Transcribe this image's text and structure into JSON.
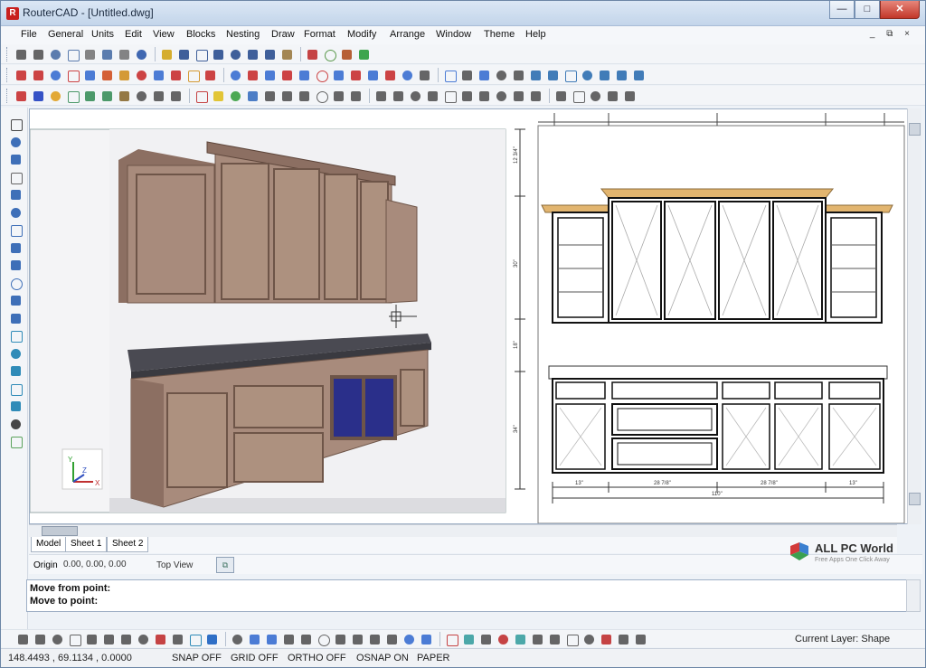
{
  "window": {
    "title": "RouterCAD - [Untitled.dwg]",
    "app_icon_glyph": "R",
    "controls": {
      "minimize": "—",
      "maximize": "□",
      "close": "✕"
    }
  },
  "menu": {
    "items": [
      "File",
      "General",
      "Units",
      "Edit",
      "View",
      "Blocks",
      "Nesting",
      "Draw",
      "Format",
      "Modify",
      "Arrange",
      "Window",
      "Theme",
      "Help"
    ],
    "mdi_controls": "_ ⧉ ×"
  },
  "toolbar_colors": {
    "row1": [
      "#555",
      "#555",
      "#4a6fa5",
      "#4a6fa5",
      "#777",
      "#4a6fa5",
      "#777",
      "#2b58a8",
      "#d1a517",
      "#2b4f8f",
      "#2b4f8f",
      "#2b4f8f",
      "#2b4f8f",
      "#2b4f8f",
      "#2b4f8f",
      "#9a7a40",
      "#c03030",
      "#4a8f3a",
      "#b05020",
      "#2a9c3a"
    ],
    "row2": [
      "#c83030",
      "#c83030",
      "#3a6fd0",
      "#c83030",
      "#3a6fd0",
      "#d05020",
      "#d09020",
      "#c83030",
      "#3a6fd0",
      "#c83030",
      "#d09020",
      "#c83030",
      "#3a6fd0",
      "#c83030",
      "#3a6fd0",
      "#c83030",
      "#3a6fd0",
      "#c83030",
      "#3a6fd0",
      "#c83030",
      "#3a6fd0",
      "#c83030",
      "#3a6fd0",
      "#555",
      "#3a6fd0",
      "#555",
      "#3a6fd0",
      "#555",
      "#555",
      "#2e6fb0",
      "#2e6fb0",
      "#2e6fb0",
      "#2e6fb0",
      "#2e6fb0",
      "#2e6fb0",
      "#2e6fb0"
    ],
    "row3": [
      "#c83030",
      "#2040c0",
      "#e0a020",
      "#3a8f5a",
      "#3a8f5a",
      "#3a8f5a",
      "#8a6a30",
      "#555",
      "#555",
      "#555",
      "#c03030",
      "#e0c020",
      "#3aa040",
      "#3a70c0",
      "#555",
      "#555",
      "#555",
      "#555",
      "#555",
      "#555",
      "#555",
      "#555",
      "#555",
      "#555",
      "#555",
      "#555",
      "#555",
      "#555",
      "#555",
      "#555",
      "#555",
      "#555",
      "#555",
      "#555",
      "#555"
    ],
    "left": [
      "#333",
      "#2a60b0",
      "#2a60b0",
      "#555",
      "#2a60b0",
      "#2a60b0",
      "#2a60b0",
      "#2a60b0",
      "#2a60b0",
      "#2a60b0",
      "#2a60b0",
      "#2a60b0",
      "#1a80b0",
      "#1a80b0",
      "#1a80b0",
      "#1a80b0",
      "#1a80b0",
      "#333",
      "#4a9a4a"
    ],
    "bottom": [
      "#555",
      "#555",
      "#555",
      "#555",
      "#555",
      "#555",
      "#555",
      "#555",
      "#c03030",
      "#555",
      "#1a80b0",
      "#1a60c0",
      "#555",
      "#3a6fd0",
      "#3a6fd0",
      "#555",
      "#555",
      "#555",
      "#555",
      "#555",
      "#555",
      "#555",
      "#3a6fd0",
      "#3a6fd0",
      "#c03030",
      "#3aa0a0",
      "#555",
      "#c03030",
      "#3aa0a0",
      "#555",
      "#555",
      "#555",
      "#555",
      "#c03030",
      "#555",
      "#555"
    ]
  },
  "tabs": [
    "Model",
    "Sheet 1",
    "Sheet 2"
  ],
  "info": {
    "origin_label": "Origin",
    "origin_value": "0.00, 0.00, 0.00",
    "view_label": "Top View",
    "view_icon_glyph": "⧉"
  },
  "watermark": {
    "title": "ALL PC World",
    "subtitle": "Free Apps One Click Away"
  },
  "command": {
    "lines": [
      "Move from point:",
      "Move to point:"
    ]
  },
  "bottom_bar": {
    "current_layer": "Current Layer: Shape"
  },
  "status": {
    "coords": "148.4493 , 69.1134 , 0.0000",
    "snap": "SNAP OFF",
    "grid": "GRID OFF",
    "ortho": "ORTHO OFF",
    "osnap": "OSNAP ON",
    "paper": "PAPER"
  },
  "canvas": {
    "axes": {
      "x": "X",
      "y": "Y",
      "z": "Z"
    },
    "dim_labels": {
      "bottom_segments": [
        "13\"",
        "28 7/8\"",
        "28 7/8\"",
        "13\""
      ],
      "bottom_total": "110\"",
      "left_segments": [
        "12 3/4\"",
        "30\"",
        "18\"",
        "34\""
      ]
    },
    "colors": {
      "cabinet_face": "#a88b7c",
      "cabinet_side": "#8c6f62",
      "cabinet_dark": "#6e5548",
      "countertop": "#4a4a52",
      "glass": "#2a2f8a",
      "crown": "#e2b56f",
      "wall": "#f4f4f6"
    }
  }
}
